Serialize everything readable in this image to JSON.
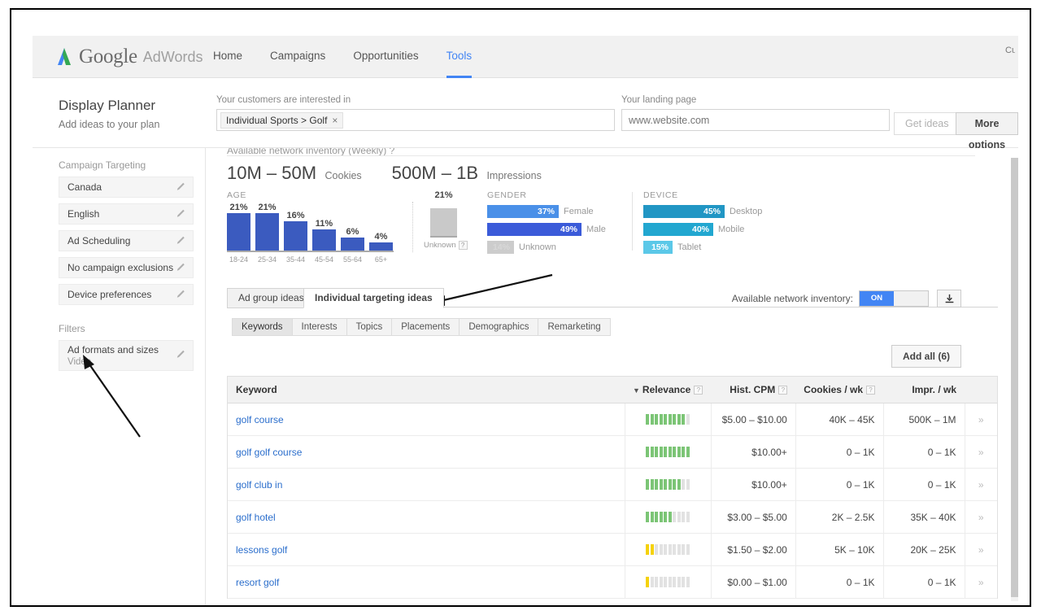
{
  "topnav": {
    "brand_google": "Google",
    "brand_product": "AdWords",
    "items": [
      {
        "label": "Home",
        "active": false
      },
      {
        "label": "Campaigns",
        "active": false
      },
      {
        "label": "Opportunities",
        "active": false
      },
      {
        "label": "Tools",
        "active": true
      }
    ],
    "account_text": "Cu\nr"
  },
  "planner": {
    "title": "Display Planner",
    "subtitle": "Add ideas to your plan",
    "interest_label": "Your customers are interested in",
    "interest_chip": "Individual Sports > Golf",
    "chip_remove": "×",
    "landing_label": "Your landing page",
    "landing_placeholder": "www.website.com",
    "landing_value": "",
    "get_ideas_label": "Get ideas",
    "more_options_label": "More options"
  },
  "sidebar": {
    "targeting_title": "Campaign Targeting",
    "targeting_items": [
      {
        "label": "Canada"
      },
      {
        "label": "English"
      },
      {
        "label": "Ad Scheduling"
      },
      {
        "label": "No campaign exclusions"
      },
      {
        "label": "Device preferences"
      }
    ],
    "filters_title": "Filters",
    "filter_items": [
      {
        "label": "Ad formats and sizes",
        "sub": "Video"
      }
    ]
  },
  "inventory": {
    "strip_text": "Available network inventory (Weekly) ?",
    "cookies_value": "10M – 50M",
    "cookies_unit": "Cookies",
    "impressions_value": "500M – 1B",
    "impressions_unit": "Impressions"
  },
  "chart_data": [
    {
      "type": "bar",
      "title": "AGE",
      "categories": [
        "18-24",
        "25-34",
        "35-44",
        "45-54",
        "55-64",
        "65+"
      ],
      "values": [
        21,
        21,
        16,
        11,
        6,
        4
      ],
      "value_labels": [
        "21%",
        "21%",
        "16%",
        "11%",
        "6%",
        "4%"
      ],
      "ylim": [
        0,
        25
      ],
      "xlabel": "",
      "ylabel": "",
      "grid": false,
      "color": "#3b5bbf",
      "extra": {
        "unknown_label": "Unknown",
        "unknown_value": 21,
        "unknown_value_label": "21%",
        "unknown_color": "#c9c9c9",
        "help_glyph": "?"
      }
    },
    {
      "type": "bar",
      "title": "GENDER",
      "orientation": "horizontal",
      "categories": [
        "Female",
        "Male",
        "Unknown"
      ],
      "values": [
        37,
        49,
        14
      ],
      "value_labels": [
        "37%",
        "49%",
        "14%"
      ],
      "colors": [
        "#4a90e8",
        "#3b5bd9",
        "#cccccc"
      ],
      "ylim": [
        0,
        100
      ]
    },
    {
      "type": "bar",
      "title": "DEVICE",
      "orientation": "horizontal",
      "categories": [
        "Desktop",
        "Mobile",
        "Tablet"
      ],
      "values": [
        45,
        40,
        15
      ],
      "value_labels": [
        "45%",
        "40%",
        "15%"
      ],
      "colors": [
        "#2196c4",
        "#22a7d0",
        "#5bc8e8"
      ],
      "ylim": [
        0,
        100
      ]
    }
  ],
  "tabs": [
    {
      "label": "Ad group ideas",
      "active": false
    },
    {
      "label": "Individual targeting ideas",
      "active": true
    }
  ],
  "subtabs": [
    {
      "label": "Keywords",
      "active": true
    },
    {
      "label": "Interests",
      "active": false
    },
    {
      "label": "Topics",
      "active": false
    },
    {
      "label": "Placements",
      "active": false
    },
    {
      "label": "Demographics",
      "active": false
    },
    {
      "label": "Remarketing",
      "active": false
    }
  ],
  "toolbar": {
    "inventory_toggle_label": "Available network inventory:",
    "toggle_on_text": "ON",
    "download_icon": "download-icon",
    "add_all_label": "Add all (6)"
  },
  "table": {
    "headers": {
      "keyword": "Keyword",
      "relevance": "Relevance",
      "relevance_caret": "▼",
      "hist_cpm": "Hist. CPM",
      "cookies_wk": "Cookies / wk",
      "impr_wk": "Impr. / wk",
      "help_glyph": "?"
    },
    "rows": [
      {
        "keyword": "golf course",
        "relevance": 9,
        "cpm": "$5.00 – $10.00",
        "cookies": "40K – 45K",
        "impr": "500K – 1M",
        "arrow": "»",
        "rel_color": "green"
      },
      {
        "keyword": "golf golf course",
        "relevance": 10,
        "cpm": "$10.00+",
        "cookies": "0 – 1K",
        "impr": "0 – 1K",
        "arrow": "»",
        "rel_color": "green"
      },
      {
        "keyword": "golf club in",
        "relevance": 8,
        "cpm": "$10.00+",
        "cookies": "0 – 1K",
        "impr": "0 – 1K",
        "arrow": "»",
        "rel_color": "green"
      },
      {
        "keyword": "golf hotel",
        "relevance": 6,
        "cpm": "$3.00 – $5.00",
        "cookies": "2K – 2.5K",
        "impr": "35K – 40K",
        "arrow": "»",
        "rel_color": "green"
      },
      {
        "keyword": "lessons golf",
        "relevance": 2,
        "cpm": "$1.50 – $2.00",
        "cookies": "5K – 10K",
        "impr": "20K – 25K",
        "arrow": "»",
        "rel_color": "yellow"
      },
      {
        "keyword": "resort golf",
        "relevance": 1,
        "cpm": "$0.00 – $1.00",
        "cookies": "0 – 1K",
        "impr": "0 – 1K",
        "arrow": "»",
        "rel_color": "yellow"
      }
    ]
  },
  "colors": {
    "accent_blue": "#4285f4",
    "link_blue": "#2b6ecc",
    "age_bar": "#3b5bbf",
    "relevance_green": "#7cc576",
    "relevance_yellow": "#f5d20c"
  }
}
